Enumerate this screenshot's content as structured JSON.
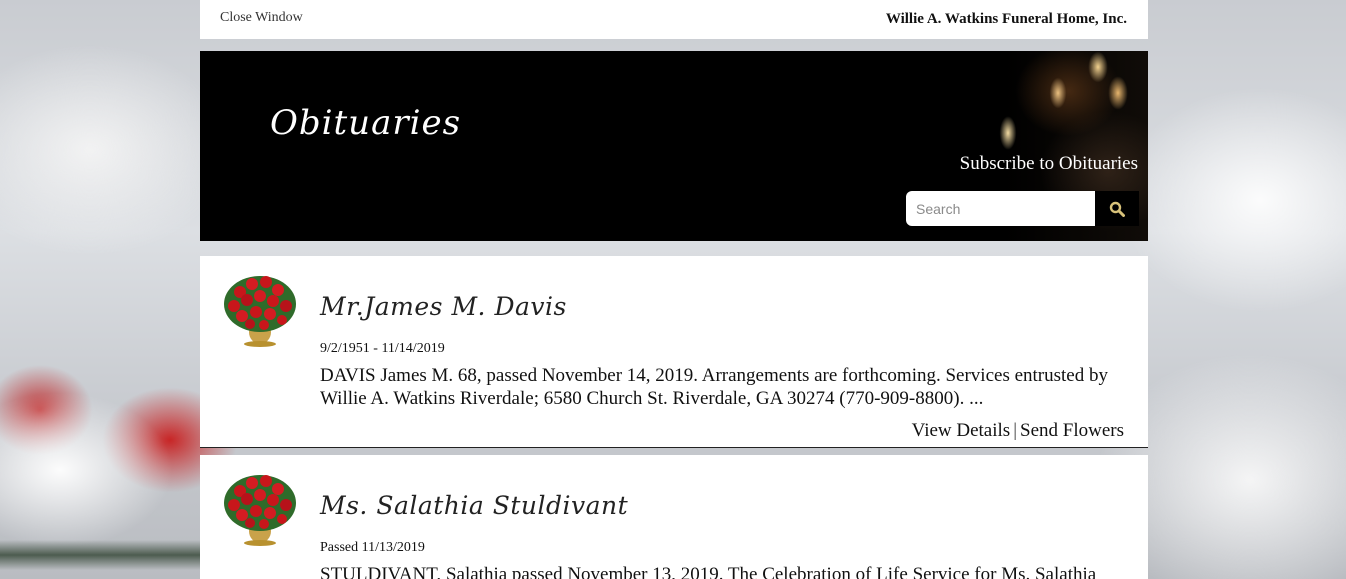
{
  "top_bar": {
    "close_label": "Close Window",
    "company_name": "Willie A. Watkins Funeral Home, Inc."
  },
  "hero": {
    "title": "Obituaries",
    "subscribe_label": "Subscribe to Obituaries",
    "search_placeholder": "Search",
    "search_icon": "search-icon"
  },
  "obituaries": [
    {
      "photo_icon": "flower-basket-icon",
      "name": "Mr.James M. Davis",
      "date": "9/2/1951 - 11/14/2019",
      "excerpt": "DAVIS James M. 68, passed November 14, 2019. Arrangements are forthcoming. Services entrusted by Willie A. Watkins Riverdale; 6580 Church St. Riverdale, GA 30274 (770-909-8800). ...",
      "view_details_label": "View Details",
      "separator": "|",
      "send_flowers_label": "Send Flowers"
    },
    {
      "photo_icon": "flower-basket-icon",
      "name": "Ms. Salathia Stuldivant",
      "date": "Passed 11/13/2019",
      "excerpt": "STULDIVANT, Salathia passed November 13, 2019. The Celebration of Life Service for Ms. Salathia"
    }
  ],
  "colors": {
    "hero_background": "#000000",
    "search_icon": "#d8c27a",
    "rose": "#c8161b"
  }
}
